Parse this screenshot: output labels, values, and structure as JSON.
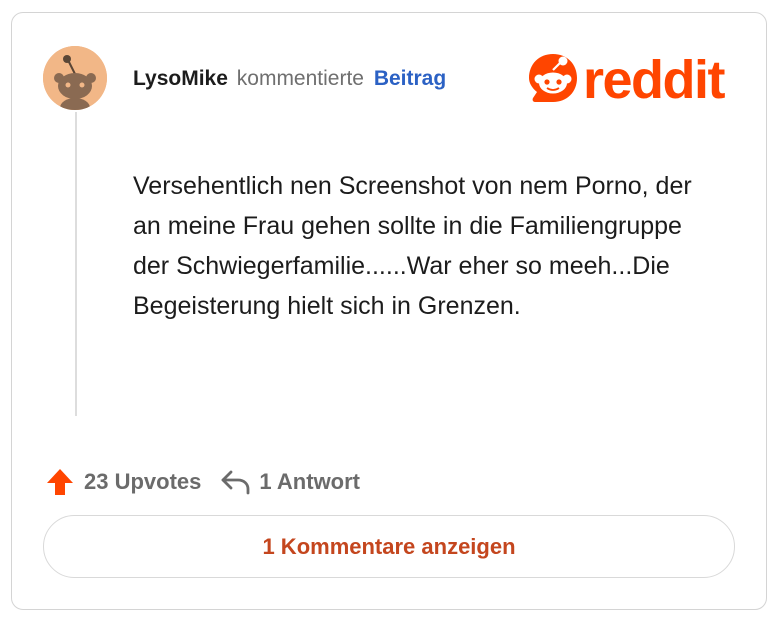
{
  "comment": {
    "username": "LysoMike",
    "action_text": "kommentierte",
    "post_link_text": "Beitrag",
    "body": "Versehentlich nen Screenshot von nem Porno, der an meine Frau gehen sollte in die Familiengruppe der Schwiegerfamilie......War eher so meeh...Die Begeisterung hielt sich in Grenzen.",
    "upvotes_label": "23 Upvotes",
    "replies_label": "1 Antwort",
    "view_comments_label": "1 Kommentare anzeigen"
  },
  "brand": {
    "wordmark": "reddit",
    "color": "#ff4500"
  },
  "colors": {
    "upvote": "#ff4500",
    "link": "#2b61c4",
    "view_comments": "#c4461e",
    "avatar_bg": "#f2b787"
  },
  "icons": {
    "avatar": "snoo-avatar-icon",
    "logo": "reddit-snoo-icon",
    "upvote": "upvote-arrow-icon",
    "reply": "reply-arrow-icon"
  }
}
